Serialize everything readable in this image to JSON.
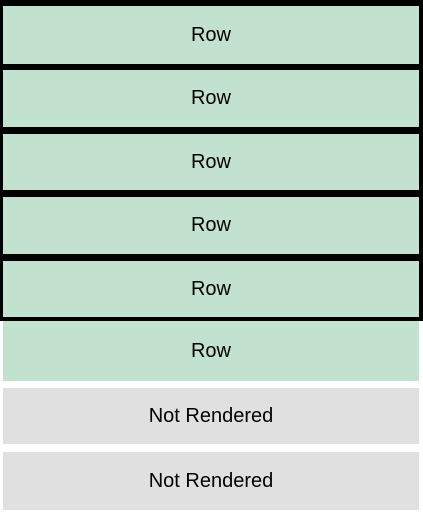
{
  "colors": {
    "rendered_row": "#c2e2cf",
    "not_rendered_row": "#e0e0e0",
    "viewport_border": "#000000"
  },
  "rows": [
    {
      "label": "Row",
      "state": "rendered"
    },
    {
      "label": "Row",
      "state": "rendered"
    },
    {
      "label": "Row",
      "state": "rendered"
    },
    {
      "label": "Row",
      "state": "rendered"
    },
    {
      "label": "Row",
      "state": "rendered"
    },
    {
      "label": "Row",
      "state": "rendered"
    },
    {
      "label": "Not Rendered",
      "state": "not-rendered"
    },
    {
      "label": "Not Rendered",
      "state": "not-rendered"
    }
  ]
}
